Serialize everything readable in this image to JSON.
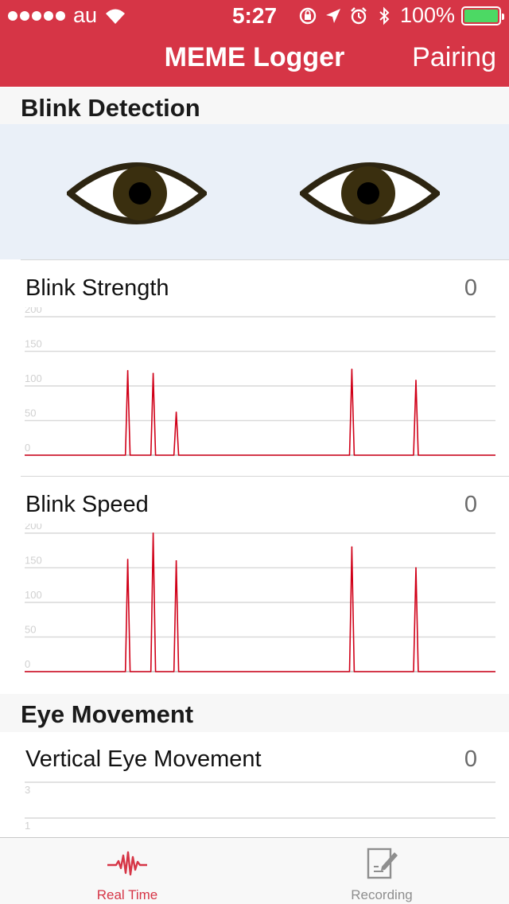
{
  "status_bar": {
    "carrier": "au",
    "time": "5:27",
    "battery": "100%",
    "battery_color": "#4cd964"
  },
  "nav": {
    "title": "MEME Logger",
    "pairing_label": "Pairing",
    "color": "#d63546"
  },
  "sections": {
    "blink_detection": "Blink Detection",
    "eye_movement": "Eye Movement"
  },
  "eyes": {
    "icon": "eye-icon",
    "count": 2
  },
  "blink_strength": {
    "title": "Blink Strength",
    "value": "0"
  },
  "blink_speed": {
    "title": "Blink Speed",
    "value": "0"
  },
  "vertical_eye_movement": {
    "title": "Vertical Eye Movement",
    "value": "0"
  },
  "tabs": [
    {
      "label": "Real Time",
      "icon": "waveform-icon",
      "selected": true
    },
    {
      "label": "Recording",
      "icon": "notepad-edit-icon",
      "selected": false
    }
  ],
  "colors": {
    "accent": "#d63546",
    "line": "#d00018",
    "tab_selected": "#d63546",
    "tab_unselected": "#8e8e8e",
    "eye_panel": "#eaf0f8"
  },
  "chart_data": [
    {
      "type": "line",
      "title": "Blink Strength",
      "yticks": [
        "0",
        "50",
        "100",
        "150",
        "200"
      ],
      "ylim": [
        0,
        200
      ],
      "xlim": [
        0,
        100
      ],
      "grid": true,
      "x": [
        0,
        21.4,
        21.9,
        22.4,
        26.8,
        27.3,
        27.8,
        31.7,
        32.2,
        32.7,
        69.0,
        69.5,
        70.0,
        82.6,
        83.1,
        83.6,
        100
      ],
      "y": [
        0,
        0,
        122,
        0,
        0,
        118,
        0,
        0,
        62,
        0,
        0,
        124,
        0,
        0,
        108,
        0,
        0
      ]
    },
    {
      "type": "line",
      "title": "Blink Speed",
      "yticks": [
        "0",
        "50",
        "100",
        "150",
        "200"
      ],
      "ylim": [
        0,
        200
      ],
      "xlim": [
        0,
        100
      ],
      "grid": true,
      "x": [
        0,
        21.4,
        21.9,
        22.4,
        26.8,
        27.3,
        27.8,
        31.7,
        32.2,
        32.7,
        69.0,
        69.5,
        70.0,
        82.6,
        83.1,
        83.6,
        100
      ],
      "y": [
        0,
        0,
        162,
        0,
        0,
        200,
        0,
        0,
        160,
        0,
        0,
        180,
        0,
        0,
        150,
        0,
        0
      ]
    },
    {
      "type": "line",
      "title": "Vertical Eye Movement",
      "yticks": [
        "3",
        "1"
      ],
      "grid": true,
      "x": [],
      "y": []
    }
  ]
}
